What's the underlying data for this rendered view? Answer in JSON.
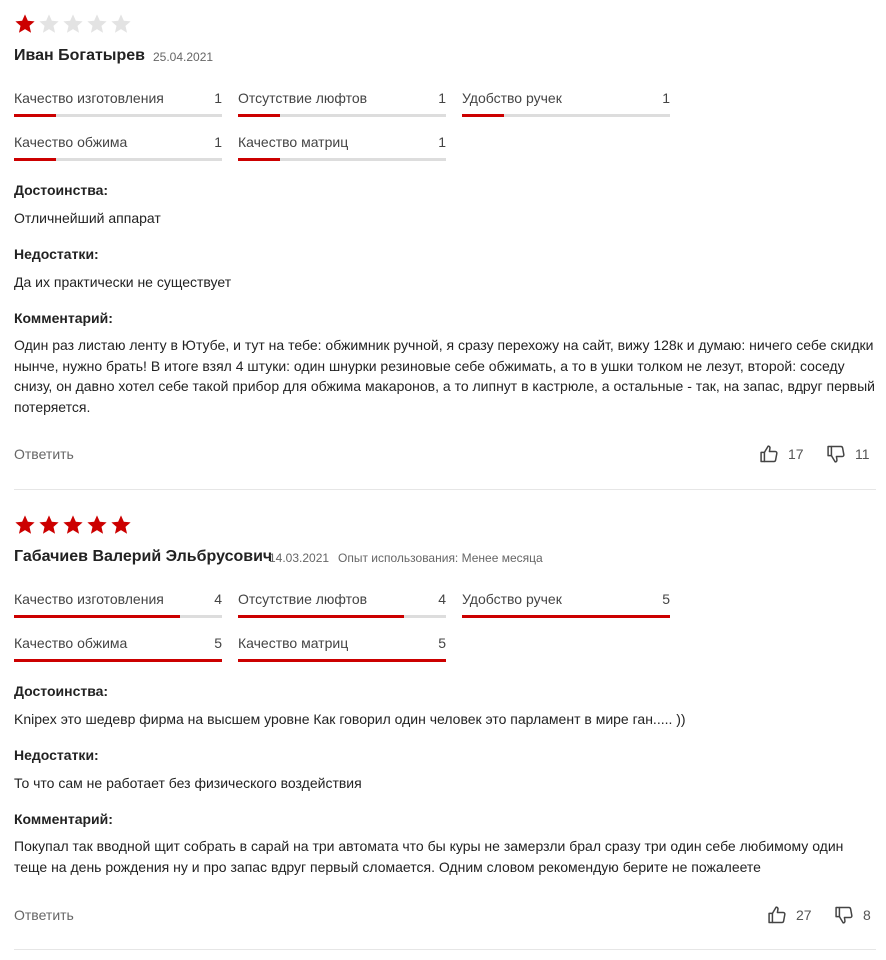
{
  "colors": {
    "accent": "#cc0000",
    "star_empty": "#e3e3e3",
    "track": "#dddddd"
  },
  "icons": {
    "star": "star-icon",
    "like": "thumbs-up-icon",
    "dislike": "thumbs-down-icon"
  },
  "reviews": [
    {
      "rating": 1,
      "author": "Иван Богатырев",
      "date": "25.04.2021",
      "usage": "",
      "metrics": [
        {
          "label": "Качество изготовления",
          "value": "1",
          "fraction": 0.2
        },
        {
          "label": "Отсутствие люфтов",
          "value": "1",
          "fraction": 0.2
        },
        {
          "label": "Удобство ручек",
          "value": "1",
          "fraction": 0.2
        },
        {
          "label": "Качество обжима",
          "value": "1",
          "fraction": 0.2
        },
        {
          "label": "Качество матриц",
          "value": "1",
          "fraction": 0.2
        }
      ],
      "pros_title": "Достоинства:",
      "pros": "Отличнейший аппарат",
      "cons_title": "Недостатки:",
      "cons": "Да их практически не существует",
      "comment_title": "Комментарий:",
      "comment": "Один раз листаю ленту в Ютубе, и тут на тебе: обжимник ручной, я сразу перехожу на сайт, вижу 128к и думаю: ничего себе скидки нынче, нужно брать! В итоге взял 4 штуки: один шнурки резиновые себе обжимать, а то в ушки толком не лезут, второй: соседу снизу, он давно хотел себе такой прибор для обжима макаронов, а то липнут в кастрюле, а остальные - так, на запас, вдруг первый потеряется.",
      "reply_label": "Ответить",
      "likes": "17",
      "dislikes": "11"
    },
    {
      "rating": 5,
      "author": "Габачиев Валерий Эльбрусович",
      "date": "14.03.2021",
      "usage": "Опыт использования: Менее месяца",
      "metrics": [
        {
          "label": "Качество изготовления",
          "value": "4",
          "fraction": 0.8
        },
        {
          "label": "Отсутствие люфтов",
          "value": "4",
          "fraction": 0.8
        },
        {
          "label": "Удобство ручек",
          "value": "5",
          "fraction": 1.0
        },
        {
          "label": "Качество обжима",
          "value": "5",
          "fraction": 1.0
        },
        {
          "label": "Качество матриц",
          "value": "5",
          "fraction": 1.0
        }
      ],
      "pros_title": "Достоинства:",
      "pros": "Knipex это шедевр фирма на высшем уровне Как говорил один человек это парламент в мире ган..... ))",
      "cons_title": "Недостатки:",
      "cons": "То что сам не работает без физического воздействия",
      "comment_title": "Комментарий:",
      "comment": "Покупал так вводной щит собрать в сарай на три автомата что бы куры не замерзли брал сразу три один себе любимому один теще на день рождения ну и про запас вдруг первый сломается. Одним словом рекомендую берите не пожалеете",
      "reply_label": "Ответить",
      "likes": "27",
      "dislikes": "8"
    }
  ]
}
